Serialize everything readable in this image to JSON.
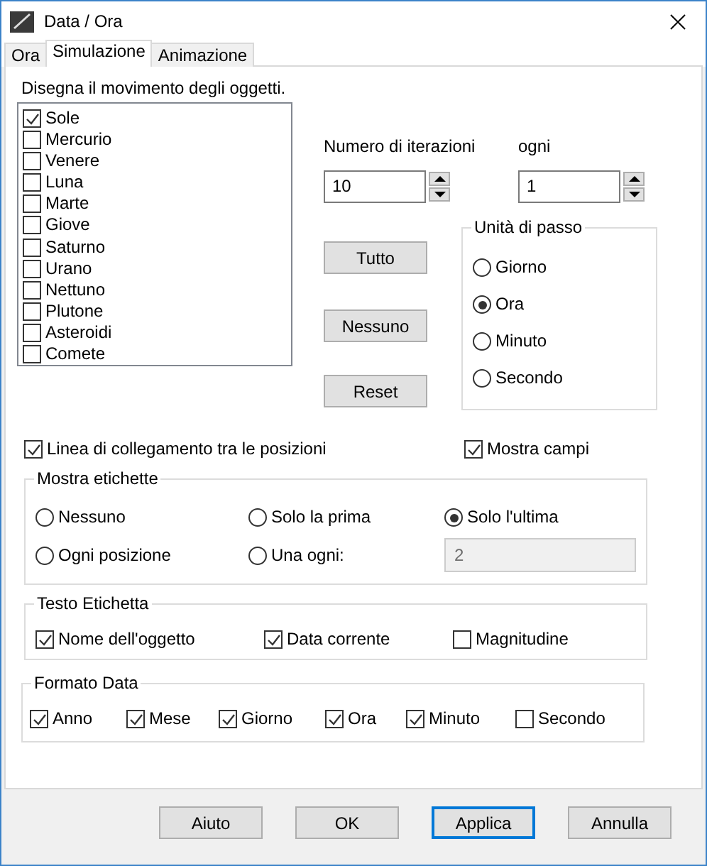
{
  "window": {
    "title": "Data / Ora"
  },
  "tabs": [
    {
      "label": "Ora",
      "selected": false
    },
    {
      "label": "Simulazione",
      "selected": true
    },
    {
      "label": "Animazione",
      "selected": false
    }
  ],
  "objects": {
    "label": "Disegna il movimento degli oggetti.",
    "items": [
      {
        "label": "Sole",
        "checked": true
      },
      {
        "label": "Mercurio",
        "checked": false
      },
      {
        "label": "Venere",
        "checked": false
      },
      {
        "label": "Luna",
        "checked": false
      },
      {
        "label": "Marte",
        "checked": false
      },
      {
        "label": "Giove",
        "checked": false
      },
      {
        "label": "Saturno",
        "checked": false
      },
      {
        "label": "Urano",
        "checked": false
      },
      {
        "label": "Nettuno",
        "checked": false
      },
      {
        "label": "Plutone",
        "checked": false
      },
      {
        "label": "Asteroidi",
        "checked": false
      },
      {
        "label": "Comete",
        "checked": false
      }
    ]
  },
  "iterations": {
    "label": "Numero di iterazioni",
    "value": "10"
  },
  "every": {
    "label": "ogni",
    "value": "1"
  },
  "list_buttons": [
    "Tutto",
    "Nessuno",
    "Reset"
  ],
  "step_unit": {
    "title": "Unità di passo",
    "options": [
      {
        "label": "Giorno",
        "selected": false
      },
      {
        "label": "Ora",
        "selected": true
      },
      {
        "label": "Minuto",
        "selected": false
      },
      {
        "label": "Secondo",
        "selected": false
      }
    ]
  },
  "connect_line": {
    "label": "Linea di collegamento tra le posizioni",
    "checked": true
  },
  "show_fields": {
    "label": "Mostra campi",
    "checked": true
  },
  "show_labels": {
    "title": "Mostra etichette",
    "options": [
      {
        "label": "Nessuno",
        "selected": false
      },
      {
        "label": "Solo la prima",
        "selected": false
      },
      {
        "label": "Solo l'ultima",
        "selected": true
      },
      {
        "label": "Ogni posizione",
        "selected": false
      },
      {
        "label": "Una ogni:",
        "selected": false
      }
    ],
    "interval": {
      "value": "2",
      "disabled": true
    }
  },
  "label_text": {
    "title": "Testo Etichetta",
    "options": [
      {
        "label": "Nome dell'oggetto",
        "checked": true
      },
      {
        "label": "Data corrente",
        "checked": true
      },
      {
        "label": "Magnitudine",
        "checked": false
      }
    ]
  },
  "date_format": {
    "title": "Formato Data",
    "options": [
      {
        "label": "Anno",
        "checked": true
      },
      {
        "label": "Mese",
        "checked": true
      },
      {
        "label": "Giorno",
        "checked": true
      },
      {
        "label": "Ora",
        "checked": true
      },
      {
        "label": "Minuto",
        "checked": true
      },
      {
        "label": "Secondo",
        "checked": false
      }
    ]
  },
  "footer_buttons": [
    {
      "label": "Aiuto",
      "focused": false
    },
    {
      "label": "OK",
      "focused": false
    },
    {
      "label": "Applica",
      "focused": true
    },
    {
      "label": "Annulla",
      "focused": false
    }
  ]
}
